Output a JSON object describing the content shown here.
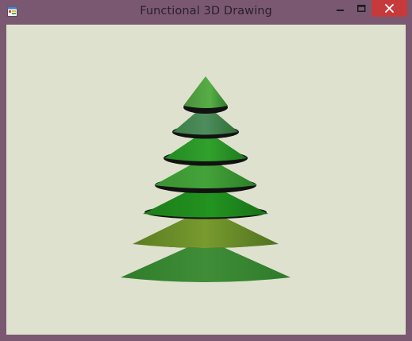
{
  "window": {
    "title": "Functional 3D Drawing",
    "frame_color": "#7a5872",
    "client_color": "#dfe1cf"
  },
  "controls": {
    "minimize_icon": "minimize-icon",
    "maximize_icon": "maximize-icon",
    "close_icon": "close-icon",
    "close_color": "#c63a3c"
  },
  "scene": {
    "object": "stacked-cone-tree",
    "tier_colors": [
      "#56a843",
      "#4f8f5a",
      "#2f8f28",
      "#3c9a32",
      "#1f8a1a",
      "#6f8e2a",
      "#3d8a34"
    ]
  }
}
